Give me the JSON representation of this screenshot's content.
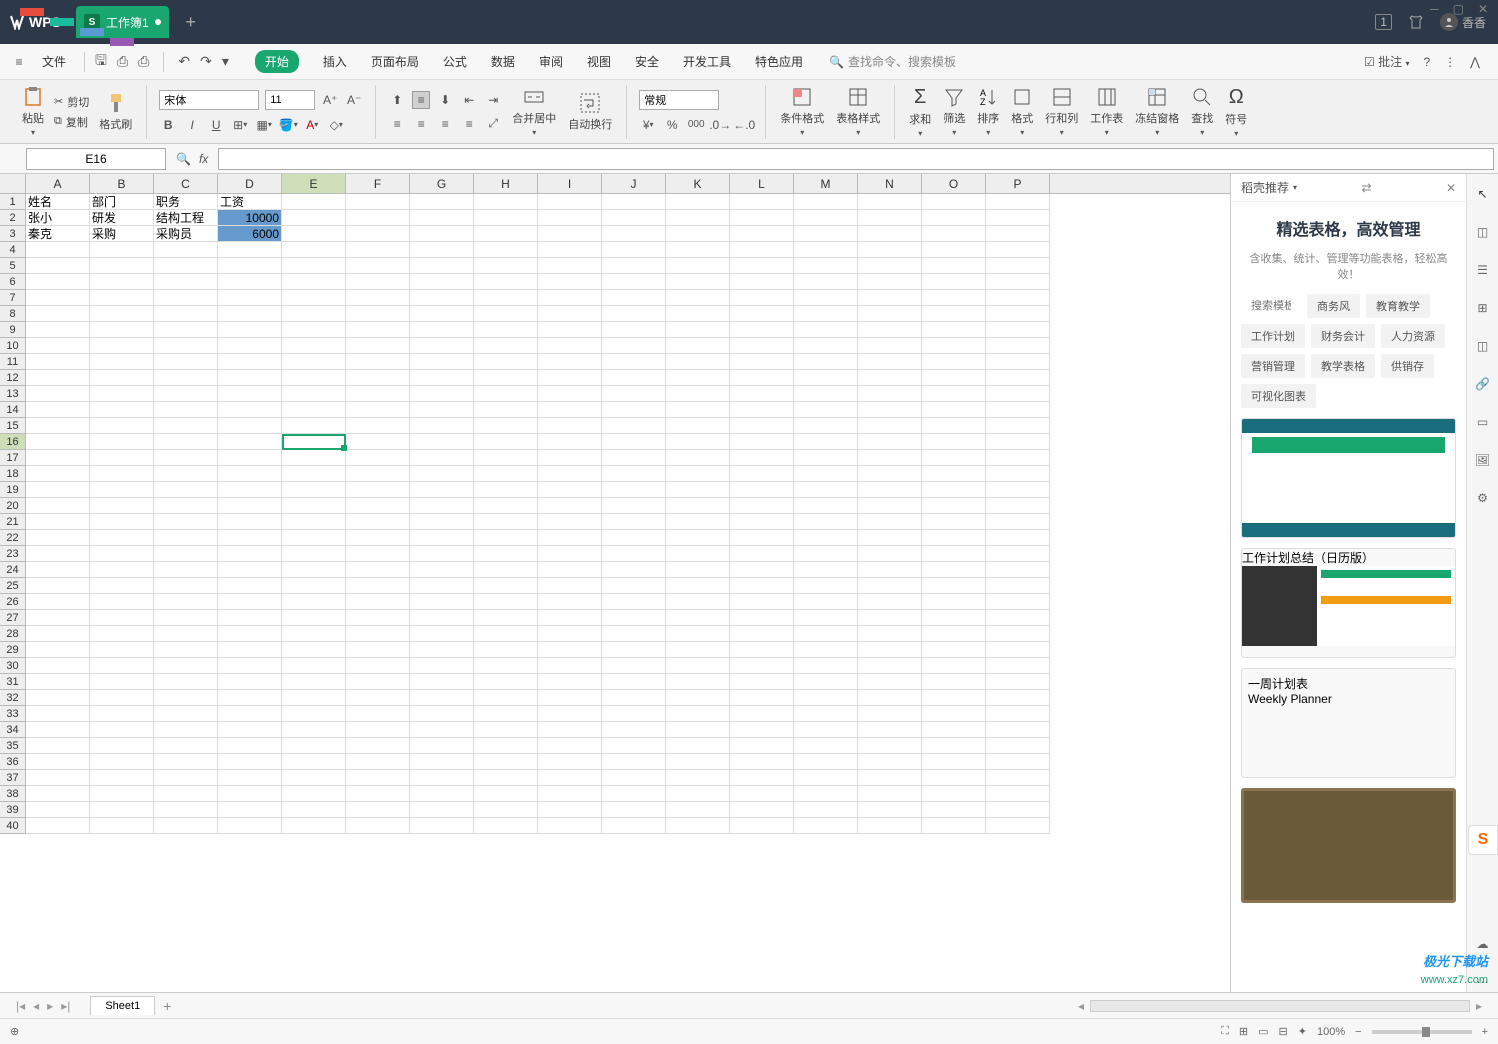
{
  "titlebar": {
    "app": "WPS",
    "tab": "工作簿1",
    "badge": "1",
    "user": "香香"
  },
  "menu": {
    "file": "文件",
    "tabs": [
      "开始",
      "插入",
      "页面布局",
      "公式",
      "数据",
      "审阅",
      "视图",
      "安全",
      "开发工具",
      "特色应用"
    ],
    "search": "查找命令、搜索模板",
    "annotate": "批注"
  },
  "ribbon": {
    "paste": "粘贴",
    "cut": "剪切",
    "copy": "复制",
    "format_painter": "格式刷",
    "font": "宋体",
    "size": "11",
    "merge": "合并居中",
    "wrap": "自动换行",
    "num_format": "常规",
    "cond_format": "条件格式",
    "table_style": "表格样式",
    "sum": "求和",
    "filter": "筛选",
    "sort": "排序",
    "format": "格式",
    "row_col": "行和列",
    "sheet": "工作表",
    "freeze": "冻结窗格",
    "find": "查找",
    "symbol": "符号"
  },
  "namebox": "E16",
  "columns": [
    "A",
    "B",
    "C",
    "D",
    "E",
    "F",
    "G",
    "H",
    "I",
    "J",
    "K",
    "L",
    "M",
    "N",
    "O",
    "P"
  ],
  "rows_visible": 40,
  "data": {
    "A1": "姓名",
    "B1": "部门",
    "C1": "职务",
    "D1": "工资",
    "A2": "张小",
    "B2": "研发",
    "C2": "结构工程",
    "D2": "10000",
    "A3": "秦克",
    "B3": "采购",
    "C3": "采购员",
    "D3": "6000"
  },
  "highlighted": [
    "D2",
    "D3"
  ],
  "active_cell": "E16",
  "sheet": {
    "name": "Sheet1"
  },
  "side": {
    "header": "稻壳推荐",
    "title": "精选表格，高效管理",
    "subtitle": "含收集、统计、管理等功能表格，轻松高效！",
    "search_ph": "搜索模板",
    "tabs": [
      "商务风",
      "教育教学",
      "工作计划",
      "财务会计",
      "人力资源",
      "营销管理",
      "教学表格",
      "供销存",
      "可视化图表"
    ],
    "tpl2_title": "工作计划总结（日历版）",
    "tpl3_title": "一周计划表",
    "tpl3_sub": "Weekly Planner"
  },
  "status": {
    "zoom": "100%"
  },
  "watermark": {
    "brand": "极光下载站",
    "url": "www.xz7.com"
  }
}
